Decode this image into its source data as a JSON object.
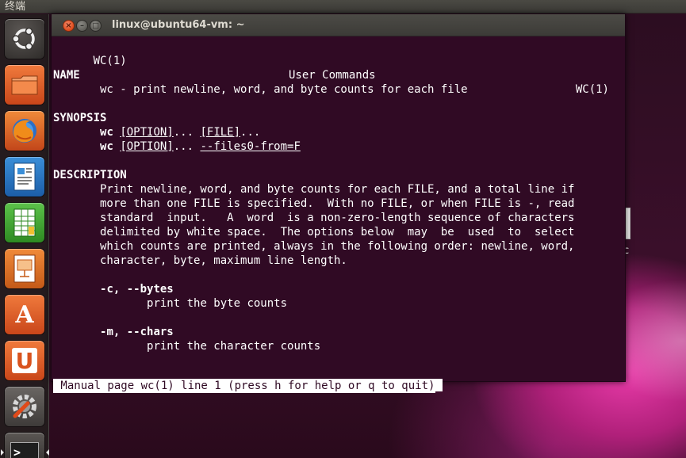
{
  "top_panel": {
    "title": "终端"
  },
  "launcher": {
    "items": [
      {
        "name": "Dash home",
        "icon": "ubuntu-logo-icon"
      },
      {
        "name": "Files",
        "icon": "folder-icon"
      },
      {
        "name": "Firefox",
        "icon": "firefox-icon"
      },
      {
        "name": "Writer",
        "icon": "writer-document-icon"
      },
      {
        "name": "Calc",
        "icon": "calc-spreadsheet-icon"
      },
      {
        "name": "Impress",
        "icon": "impress-presentation-icon"
      },
      {
        "name": "Software Center",
        "icon": "software-center-icon",
        "glyph": "A"
      },
      {
        "name": "Ubuntu One",
        "icon": "ubuntu-one-icon",
        "glyph": "U"
      },
      {
        "name": "System Settings",
        "icon": "settings-wrench-icon"
      },
      {
        "name": "Terminal",
        "icon": "terminal-icon",
        "glyph": ">_"
      }
    ]
  },
  "background_window": {
    "partial_text": "c"
  },
  "window": {
    "title": "linux@ubuntu64-vm: ~",
    "close_glyph": "×",
    "min_glyph": "–",
    "max_glyph": "□"
  },
  "manpage": {
    "header_left": "WC(1)",
    "header_center": "User Commands",
    "header_right": "WC(1)",
    "name_heading": "NAME",
    "name_text": "       wc - print newline, word, and byte counts for each file",
    "synopsis_heading": "SYNOPSIS",
    "synopsis": [
      {
        "cmd": "wc",
        "sp1": " ",
        "arg1": "[OPTION]",
        "mid": "... ",
        "arg2": "[FILE]",
        "end": "..."
      },
      {
        "cmd": "wc",
        "sp1": " ",
        "arg1": "[OPTION]",
        "mid": "... ",
        "arg2": "--files0-from=F",
        "end": ""
      }
    ],
    "description_heading": "DESCRIPTION",
    "description_lines": [
      "       Print newline, word, and byte counts for each FILE, and a total line if",
      "       more than one FILE is specified.  With no FILE, or when FILE is -, read",
      "       standard  input.   A  word  is a non-zero-length sequence of characters",
      "       delimited by white space.  The options below  may  be  used  to  select",
      "       which counts are printed, always in the following order: newline, word,",
      "       character, byte, maximum line length."
    ],
    "options": [
      {
        "flag": "-c, --bytes",
        "desc": "print the byte counts"
      },
      {
        "flag": "-m, --chars",
        "desc": "print the character counts"
      }
    ],
    "status_line": " Manual page wc(1) line 1 (press h for help or q to quit)"
  },
  "colors": {
    "terminal_bg": "#300a24",
    "terminal_fg": "#ffffff",
    "close_button": "#df4a1a"
  }
}
